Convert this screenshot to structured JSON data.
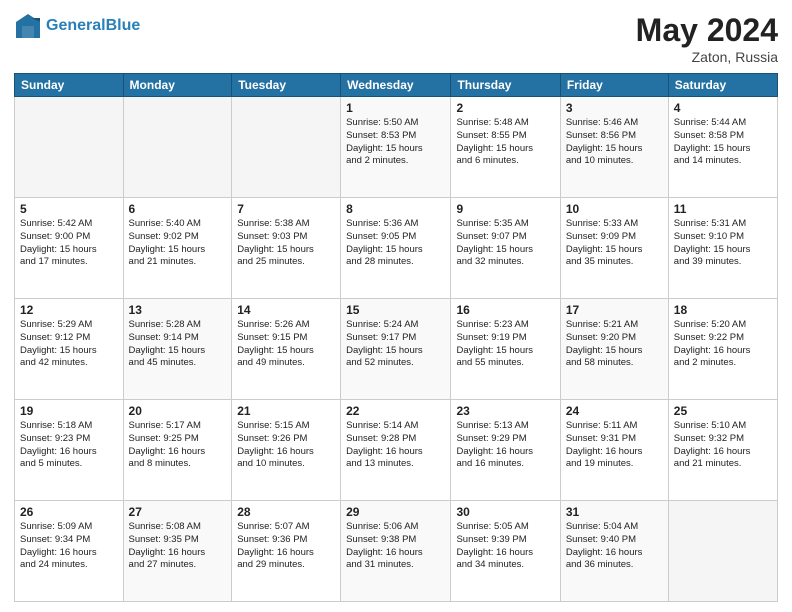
{
  "header": {
    "logo_line1": "General",
    "logo_line2": "Blue",
    "main_title": "May 2024",
    "subtitle": "Zaton, Russia"
  },
  "weekdays": [
    "Sunday",
    "Monday",
    "Tuesday",
    "Wednesday",
    "Thursday",
    "Friday",
    "Saturday"
  ],
  "weeks": [
    [
      {
        "day": "",
        "content": ""
      },
      {
        "day": "",
        "content": ""
      },
      {
        "day": "",
        "content": ""
      },
      {
        "day": "1",
        "content": "Sunrise: 5:50 AM\nSunset: 8:53 PM\nDaylight: 15 hours\nand 2 minutes."
      },
      {
        "day": "2",
        "content": "Sunrise: 5:48 AM\nSunset: 8:55 PM\nDaylight: 15 hours\nand 6 minutes."
      },
      {
        "day": "3",
        "content": "Sunrise: 5:46 AM\nSunset: 8:56 PM\nDaylight: 15 hours\nand 10 minutes."
      },
      {
        "day": "4",
        "content": "Sunrise: 5:44 AM\nSunset: 8:58 PM\nDaylight: 15 hours\nand 14 minutes."
      }
    ],
    [
      {
        "day": "5",
        "content": "Sunrise: 5:42 AM\nSunset: 9:00 PM\nDaylight: 15 hours\nand 17 minutes."
      },
      {
        "day": "6",
        "content": "Sunrise: 5:40 AM\nSunset: 9:02 PM\nDaylight: 15 hours\nand 21 minutes."
      },
      {
        "day": "7",
        "content": "Sunrise: 5:38 AM\nSunset: 9:03 PM\nDaylight: 15 hours\nand 25 minutes."
      },
      {
        "day": "8",
        "content": "Sunrise: 5:36 AM\nSunset: 9:05 PM\nDaylight: 15 hours\nand 28 minutes."
      },
      {
        "day": "9",
        "content": "Sunrise: 5:35 AM\nSunset: 9:07 PM\nDaylight: 15 hours\nand 32 minutes."
      },
      {
        "day": "10",
        "content": "Sunrise: 5:33 AM\nSunset: 9:09 PM\nDaylight: 15 hours\nand 35 minutes."
      },
      {
        "day": "11",
        "content": "Sunrise: 5:31 AM\nSunset: 9:10 PM\nDaylight: 15 hours\nand 39 minutes."
      }
    ],
    [
      {
        "day": "12",
        "content": "Sunrise: 5:29 AM\nSunset: 9:12 PM\nDaylight: 15 hours\nand 42 minutes."
      },
      {
        "day": "13",
        "content": "Sunrise: 5:28 AM\nSunset: 9:14 PM\nDaylight: 15 hours\nand 45 minutes."
      },
      {
        "day": "14",
        "content": "Sunrise: 5:26 AM\nSunset: 9:15 PM\nDaylight: 15 hours\nand 49 minutes."
      },
      {
        "day": "15",
        "content": "Sunrise: 5:24 AM\nSunset: 9:17 PM\nDaylight: 15 hours\nand 52 minutes."
      },
      {
        "day": "16",
        "content": "Sunrise: 5:23 AM\nSunset: 9:19 PM\nDaylight: 15 hours\nand 55 minutes."
      },
      {
        "day": "17",
        "content": "Sunrise: 5:21 AM\nSunset: 9:20 PM\nDaylight: 15 hours\nand 58 minutes."
      },
      {
        "day": "18",
        "content": "Sunrise: 5:20 AM\nSunset: 9:22 PM\nDaylight: 16 hours\nand 2 minutes."
      }
    ],
    [
      {
        "day": "19",
        "content": "Sunrise: 5:18 AM\nSunset: 9:23 PM\nDaylight: 16 hours\nand 5 minutes."
      },
      {
        "day": "20",
        "content": "Sunrise: 5:17 AM\nSunset: 9:25 PM\nDaylight: 16 hours\nand 8 minutes."
      },
      {
        "day": "21",
        "content": "Sunrise: 5:15 AM\nSunset: 9:26 PM\nDaylight: 16 hours\nand 10 minutes."
      },
      {
        "day": "22",
        "content": "Sunrise: 5:14 AM\nSunset: 9:28 PM\nDaylight: 16 hours\nand 13 minutes."
      },
      {
        "day": "23",
        "content": "Sunrise: 5:13 AM\nSunset: 9:29 PM\nDaylight: 16 hours\nand 16 minutes."
      },
      {
        "day": "24",
        "content": "Sunrise: 5:11 AM\nSunset: 9:31 PM\nDaylight: 16 hours\nand 19 minutes."
      },
      {
        "day": "25",
        "content": "Sunrise: 5:10 AM\nSunset: 9:32 PM\nDaylight: 16 hours\nand 21 minutes."
      }
    ],
    [
      {
        "day": "26",
        "content": "Sunrise: 5:09 AM\nSunset: 9:34 PM\nDaylight: 16 hours\nand 24 minutes."
      },
      {
        "day": "27",
        "content": "Sunrise: 5:08 AM\nSunset: 9:35 PM\nDaylight: 16 hours\nand 27 minutes."
      },
      {
        "day": "28",
        "content": "Sunrise: 5:07 AM\nSunset: 9:36 PM\nDaylight: 16 hours\nand 29 minutes."
      },
      {
        "day": "29",
        "content": "Sunrise: 5:06 AM\nSunset: 9:38 PM\nDaylight: 16 hours\nand 31 minutes."
      },
      {
        "day": "30",
        "content": "Sunrise: 5:05 AM\nSunset: 9:39 PM\nDaylight: 16 hours\nand 34 minutes."
      },
      {
        "day": "31",
        "content": "Sunrise: 5:04 AM\nSunset: 9:40 PM\nDaylight: 16 hours\nand 36 minutes."
      },
      {
        "day": "",
        "content": ""
      }
    ]
  ]
}
